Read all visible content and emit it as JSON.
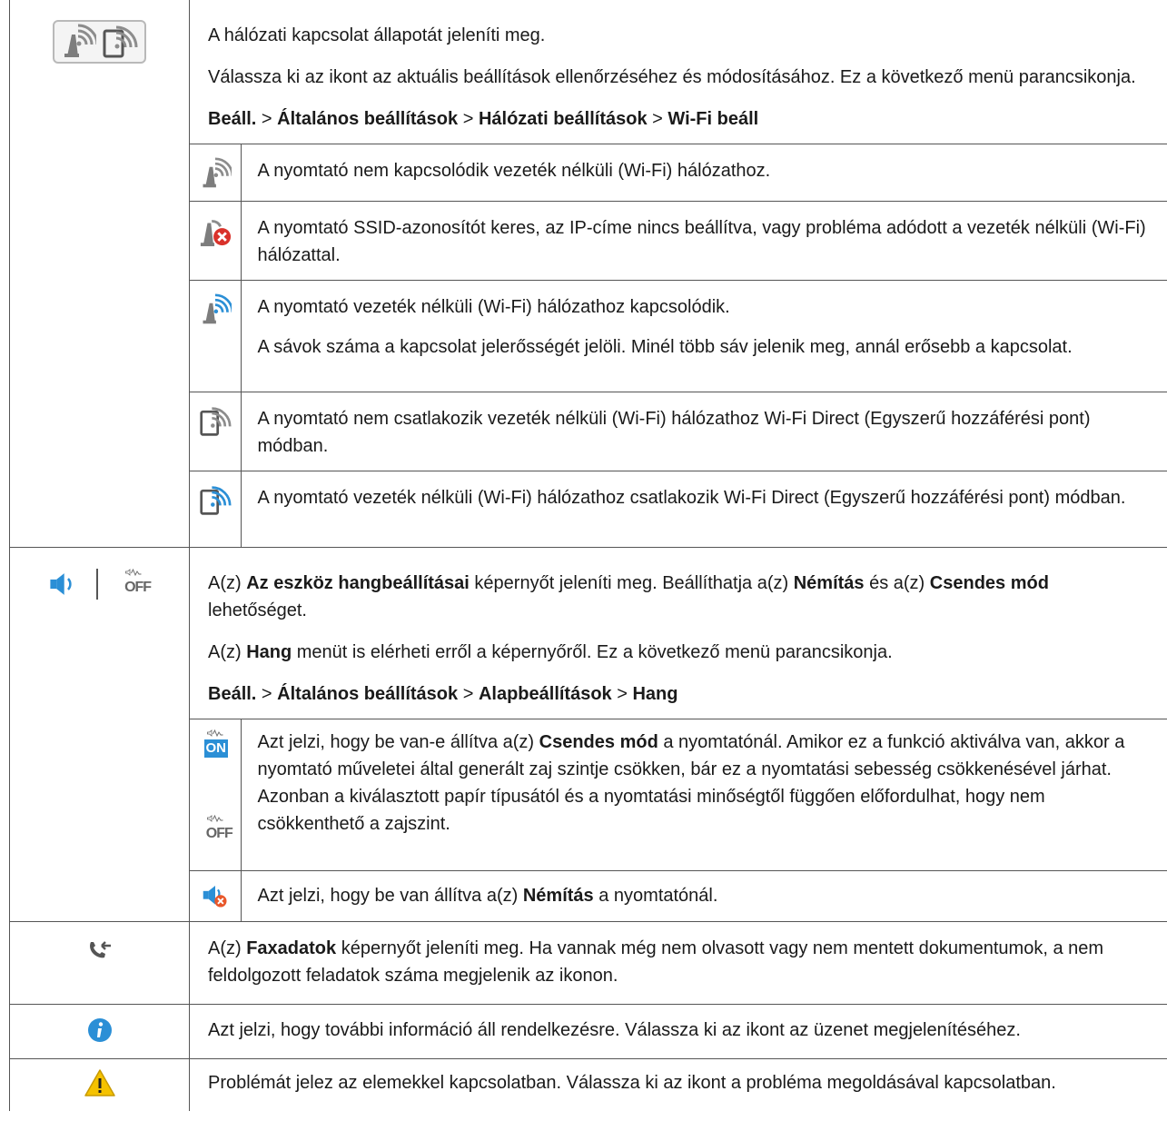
{
  "network": {
    "p1": "A hálózati kapcsolat állapotát jeleníti meg.",
    "p2": "Válassza ki az ikont az aktuális beállítások ellenőrzéséhez és módosításához. Ez a következő menü parancsikonja.",
    "path": [
      "Beáll.",
      "Általános beállítások",
      "Hálózati beállítások",
      "Wi-Fi beáll"
    ],
    "sep": ">",
    "items": [
      {
        "icon": "wifi-printer-disconnected-icon",
        "texts": [
          "A nyomtató nem kapcsolódik vezeték nélküli (Wi-Fi) hálózathoz."
        ]
      },
      {
        "icon": "wifi-printer-error-icon",
        "texts": [
          "A nyomtató SSID-azonosítót keres, az IP-címe nincs beállítva, vagy probléma adódott a vezeték nélküli (Wi-Fi) hálózattal."
        ]
      },
      {
        "icon": "wifi-printer-connected-icon",
        "texts": [
          "A nyomtató vezeték nélküli (Wi-Fi) hálózathoz kapcsolódik.",
          "A sávok száma a kapcsolat jelerősségét jelöli. Minél több sáv jelenik meg, annál erősebb a kapcsolat."
        ]
      },
      {
        "icon": "wifi-direct-disconnected-icon",
        "texts": [
          "A nyomtató nem csatlakozik vezeték nélküli (Wi-Fi) hálózathoz Wi-Fi Direct (Egyszerű hozzáférési pont) módban."
        ]
      },
      {
        "icon": "wifi-direct-connected-icon",
        "texts": [
          "A nyomtató vezeték nélküli (Wi-Fi) hálózathoz csatlakozik Wi-Fi Direct (Egyszerű hozzáférési pont) módban."
        ]
      }
    ]
  },
  "sound": {
    "p1_a": "A(z) ",
    "p1_b1": "Az eszköz hangbeállításai",
    "p1_c": " képernyőt jeleníti meg. Beállíthatja a(z) ",
    "p1_b2": "Némítás",
    "p1_d": " és a(z) ",
    "p1_b3": "Csendes mód",
    "p1_e": " lehetőséget.",
    "p2_a": "A(z) ",
    "p2_b": "Hang",
    "p2_c": " menüt is elérheti erről a képernyőről. Ez a következő menü parancsikonja.",
    "path": [
      "Beáll.",
      "Általános beállítások",
      "Alapbeállítások",
      "Hang"
    ],
    "quiet_a": "Azt jelzi, hogy be van-e állítva a(z) ",
    "quiet_b": "Csendes mód",
    "quiet_c": " a nyomtatónál. Amikor ez a funkció aktiválva van, akkor a nyomtató műveletei által generált zaj szintje csökken, bár ez a nyomtatási sebesség csökkenésével járhat. Azonban a kiválasztott papír típusától és a nyomtatási minőségtől függően előfordulhat, hogy nem csökkenthető a zajszint.",
    "mute_a": "Azt jelzi, hogy be van állítva a(z) ",
    "mute_b": "Némítás",
    "mute_c": " a nyomtatónál.",
    "on_label": "ON",
    "off_label": "OFF"
  },
  "fax": {
    "a": "A(z) ",
    "b": "Faxadatok",
    "c": " képernyőt jeleníti meg. Ha vannak még nem olvasott vagy nem mentett dokumentumok, a nem feldolgozott feladatok száma megjelenik az ikonon."
  },
  "info": {
    "text": "Azt jelzi, hogy további információ áll rendelkezésre. Válassza ki az ikont az üzenet megjelenítéséhez."
  },
  "warning": {
    "text": "Problémát jelez az elemekkel kapcsolatban. Válassza ki az ikont a probléma megoldásával kapcsolatban."
  },
  "colors": {
    "blue": "#2b8fd6",
    "gray": "#8c8c8c",
    "red": "#d9322b",
    "yellow": "#f5c200"
  }
}
